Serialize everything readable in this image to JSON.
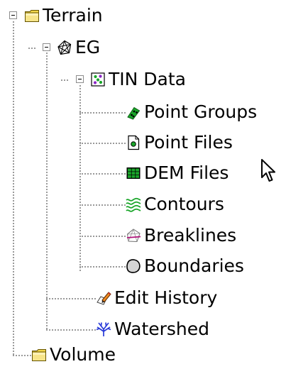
{
  "tree": {
    "terrain": {
      "label": "Terrain",
      "icon": "folder-icon",
      "children": {
        "eg": {
          "label": "EG",
          "icon": "tin-surface-icon",
          "children": {
            "tin_data": {
              "label": "TIN Data",
              "icon": "tin-data-icon",
              "children": [
                {
                  "label": "Point Groups",
                  "icon": "point-groups-icon"
                },
                {
                  "label": "Point Files",
                  "icon": "point-files-icon"
                },
                {
                  "label": "DEM Files",
                  "icon": "dem-files-icon"
                },
                {
                  "label": "Contours",
                  "icon": "contours-icon"
                },
                {
                  "label": "Breaklines",
                  "icon": "breaklines-icon"
                },
                {
                  "label": "Boundaries",
                  "icon": "boundaries-icon"
                }
              ]
            },
            "edit_history": {
              "label": "Edit History",
              "icon": "edit-history-icon"
            },
            "watershed": {
              "label": "Watershed",
              "icon": "watershed-icon"
            }
          }
        }
      }
    },
    "volume": {
      "label": "Volume",
      "icon": "folder-icon"
    }
  },
  "cursor": {
    "icon": "mouse-pointer-icon"
  },
  "colors": {
    "folder": "#f2d74a",
    "points": "#1aa62a",
    "contours": "#1aa62a",
    "watershed": "#2a3bd8",
    "tree_lines": "#9a9a9a"
  }
}
